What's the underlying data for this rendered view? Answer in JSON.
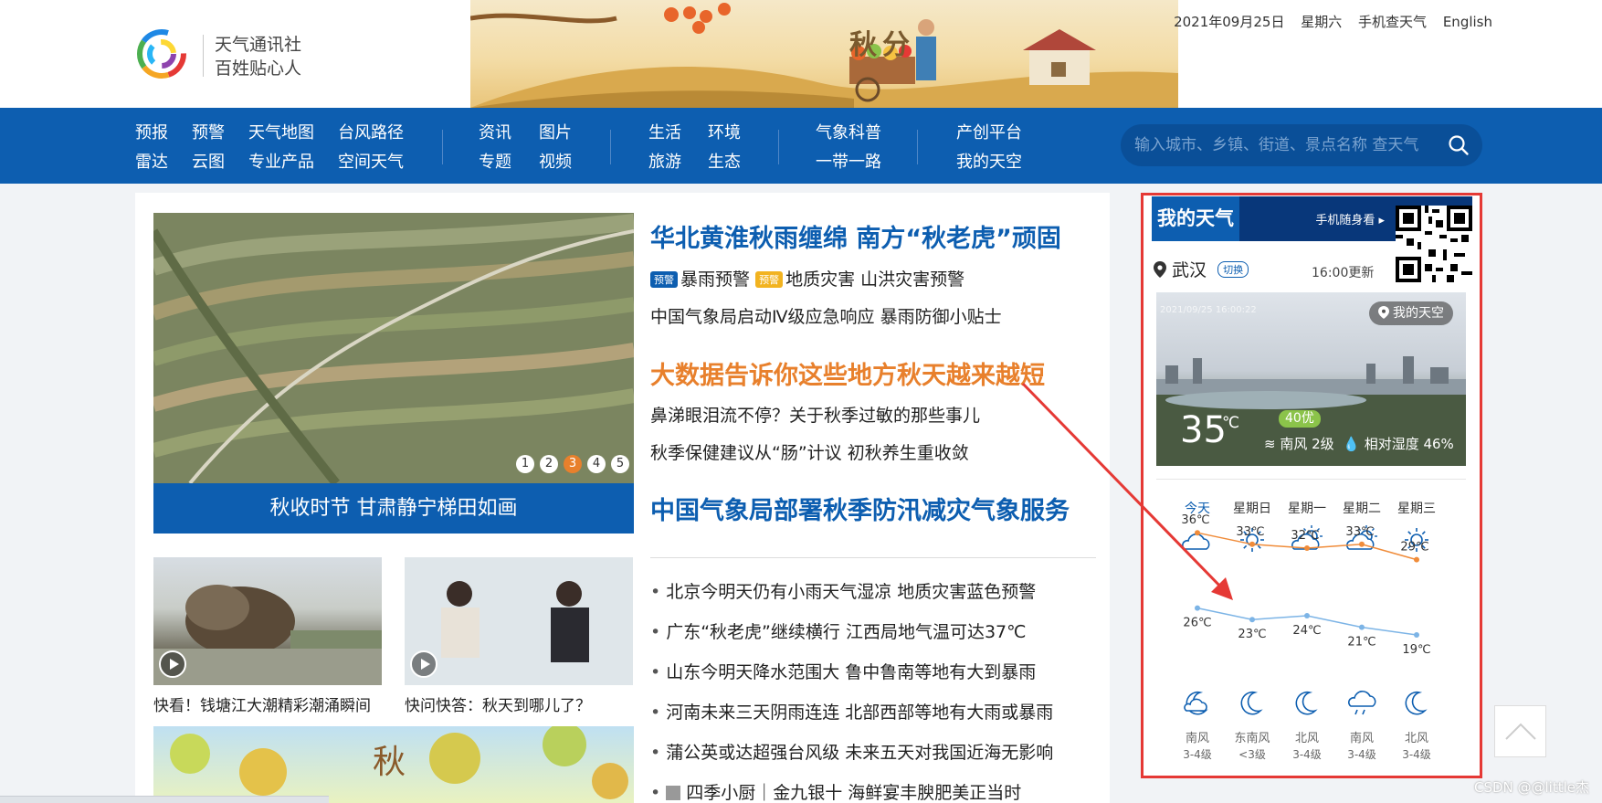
{
  "header": {
    "logo_line1": "天气通讯社",
    "logo_line2": "百姓贴心人",
    "banner_title": "秋分",
    "date": "2021年09月25日",
    "weekday": "星期六",
    "mobile_link": "手机查天气",
    "english_link": "English"
  },
  "nav": {
    "group1": {
      "row1": [
        "预报",
        "预警",
        "天气地图",
        "台风路径"
      ],
      "row2": [
        "雷达",
        "云图",
        "专业产品",
        "空间天气"
      ]
    },
    "group2": {
      "row1": [
        "资讯",
        "图片"
      ],
      "row2": [
        "专题",
        "视频"
      ]
    },
    "group3": {
      "row1": [
        "生活",
        "环境"
      ],
      "row2": [
        "旅游",
        "生态"
      ]
    },
    "group4": {
      "row1": [
        "气象科普"
      ],
      "row2": [
        "一带一路"
      ]
    },
    "group5": {
      "row1": [
        "产创平台"
      ],
      "row2": [
        "我的天空"
      ]
    },
    "search_placeholder": "输入城市、乡镇、街道、景点名称 查天气"
  },
  "hero": {
    "caption": "秋收时节 甘肃静宁梯田如画",
    "pager": [
      "1",
      "2",
      "3",
      "4",
      "5"
    ],
    "active_page": 3
  },
  "news": {
    "headline1": "华北黄淮秋雨缠绵 南方“秋老虎”顽固",
    "badge1": "预警",
    "alert1": "暴雨预警",
    "badge2": "预警",
    "alert2": "地质灾害 山洪灾害预警",
    "sub1": "中国气象局启动Ⅳ级应急响应 暴雨防御小贴士",
    "headline2": "大数据告诉你这些地方秋天越来越短",
    "sub2": "鼻涕眼泪流不停？关于秋季过敏的那些事儿",
    "sub3": "秋季保健建议从“肠”计议 初秋养生重收敛",
    "headline3": "中国气象局部署秋季防汛减灾气象服务",
    "list": [
      "北京今明天仍有小雨天气湿凉  地质灾害蓝色预警",
      "广东“秋老虎”继续横行  江西局地气温可达37℃",
      "山东今明天降水范围大 鲁中鲁南等地有大到暴雨",
      "河南未来三天阴雨连连 北部西部等地有大雨或暴雨",
      "蒲公英或达超强台风级 未来五天对我国近海无影响",
      "四季小厨｜金九银十 海鲜宴丰腴肥美正当时"
    ],
    "video1_caption": "快看！钱塘江大潮精彩潮涌瞬间",
    "video2_caption": "快问快答：秋天到哪儿了？",
    "autumn_text": "秋"
  },
  "weather": {
    "title": "我的天气",
    "mobile_label": "手机随身看 ▸",
    "city": "武汉",
    "switch_label": "切换",
    "updated": "16:00更新",
    "live_timestamp": "2021/09/25 16:00:22",
    "my_sky_label": "我的天空",
    "temp_now": "35",
    "temp_unit": "℃",
    "aqi": "40优",
    "wind": "南风 2级",
    "humidity": "相对湿度 46%",
    "days": [
      "今天",
      "星期日",
      "星期一",
      "星期二",
      "星期三"
    ],
    "day_icons": [
      "cloudy-icon",
      "sunny-icon",
      "partly-cloudy-icon",
      "partly-cloudy-icon",
      "sunny-icon"
    ],
    "high_temps": [
      36,
      33,
      32,
      33,
      29
    ],
    "high_labels": [
      "36℃",
      "33℃",
      "32℃",
      "33℃",
      "29℃"
    ],
    "low_temps": [
      26,
      23,
      24,
      21,
      19
    ],
    "low_labels": [
      "26℃",
      "23℃",
      "24℃",
      "21℃",
      "19℃"
    ],
    "night_icons": [
      "cloudy-night-icon",
      "moon-icon",
      "moon-icon",
      "rain-icon",
      "moon-icon"
    ],
    "wind_dirs": [
      "南风",
      "东南风",
      "北风",
      "南风",
      "北风"
    ],
    "wind_levels": [
      "3-4级",
      "<3级",
      "3-4级",
      "3-4级",
      "3-4级"
    ],
    "high_color": "#f08c3a",
    "low_color": "#7cb4e6"
  },
  "misc": {
    "watermark": "CSDN @@little杰"
  }
}
